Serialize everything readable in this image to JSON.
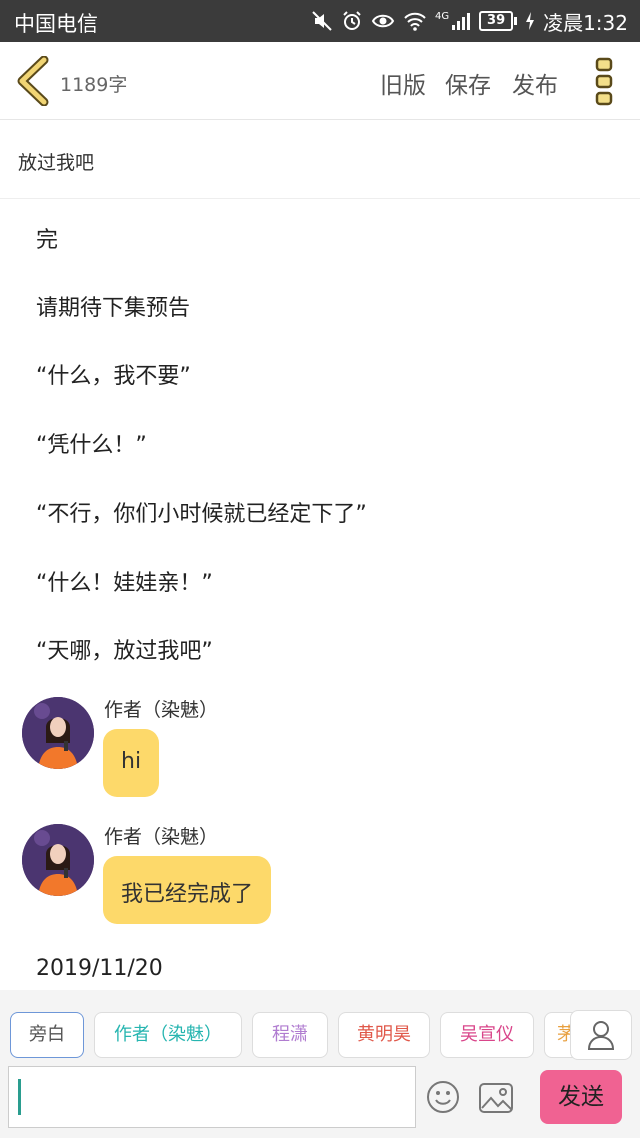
{
  "status_bar": {
    "carrier": "中国电信",
    "network": "4G",
    "battery": "39",
    "time": "凌晨1:32"
  },
  "toolbar": {
    "word_count": "1189字",
    "old_version": "旧版",
    "save": "保存",
    "publish": "发布"
  },
  "chapter": {
    "title": "放过我吧"
  },
  "content": {
    "lines": [
      "完",
      "请期待下集预告",
      "“什么，我不要”",
      "“凭什么！”",
      "“不行，你们小时候就已经定下了”",
      "“什么！娃娃亲！”",
      "“天哪，放过我吧”"
    ],
    "messages": [
      {
        "name": "作者（染魅）",
        "text": "hi"
      },
      {
        "name": "作者（染魅）",
        "text": "我已经完成了"
      }
    ],
    "date": "2019/11/20"
  },
  "role_bar": {
    "roles": [
      {
        "label": "旁白",
        "color": "#555555"
      },
      {
        "label": "作者（染魅）",
        "color": "#26b5b0"
      },
      {
        "label": "程潇",
        "color": "#b07cd0"
      },
      {
        "label": "黄明昊",
        "color": "#e0584a"
      },
      {
        "label": "吴宣仪",
        "color": "#d9458a"
      },
      {
        "label": "茅",
        "color": "#e8a040"
      }
    ],
    "send": "发送"
  }
}
